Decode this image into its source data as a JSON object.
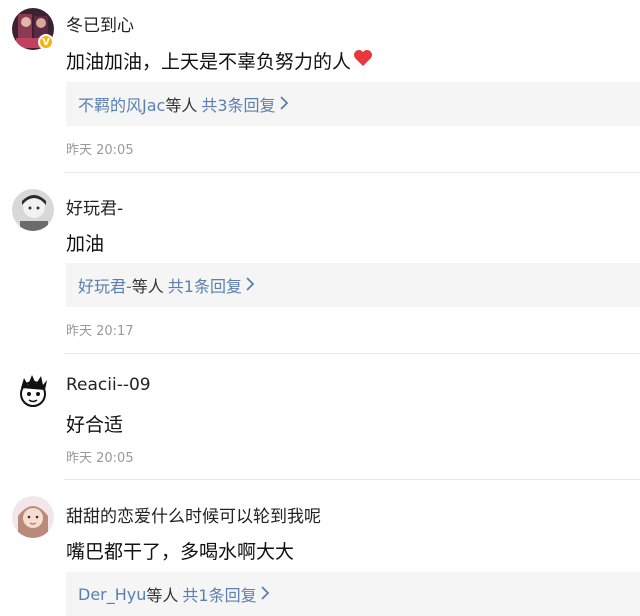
{
  "comments": [
    {
      "username": "冬已到心",
      "text": "加油加油，上天是不辜负努力的人",
      "reply_names": "不羁的风Jac",
      "reply_suffix": "等人",
      "reply_count": "共3条回复",
      "timestamp": "昨天 20:05",
      "verified_badge": "V"
    },
    {
      "username": "好玩君-",
      "text": "加油",
      "reply_names": "好玩君-",
      "reply_suffix": "等人",
      "reply_count": "共1条回复",
      "timestamp": "昨天 20:17"
    },
    {
      "username": "Reacii--09",
      "text": "好合适",
      "timestamp": "昨天 20:05"
    },
    {
      "username": "甜甜的恋爱什么时候可以轮到我呢",
      "text": "嘴巴都干了，多喝水啊大大",
      "reply_names": "Der_Hyu",
      "reply_suffix": "等人",
      "reply_count": "共1条回复"
    }
  ],
  "icons": {
    "chevron": "chevron-right-icon",
    "heart": "heart-icon",
    "heart_color": "#e8383d",
    "link_color": "#5b7fb0",
    "verified_color": "#f7b500"
  }
}
